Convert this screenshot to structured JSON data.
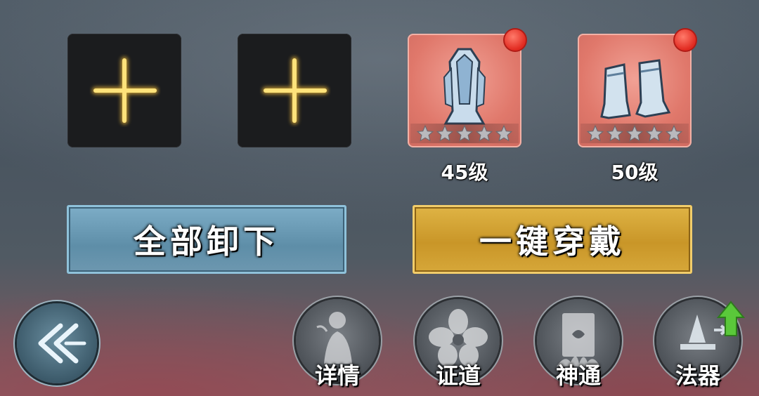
{
  "slots": [
    {
      "type": "empty",
      "icon": "plus-icon"
    },
    {
      "type": "empty",
      "icon": "plus-icon"
    },
    {
      "type": "item",
      "icon": "armor-icon",
      "stars": 5,
      "level": "45级",
      "badge": true
    },
    {
      "type": "item",
      "icon": "boots-icon",
      "stars": 5,
      "level": "50级",
      "badge": true
    }
  ],
  "actions": {
    "unequip_all": "全部卸下",
    "equip_all": "一键穿戴"
  },
  "bottom_nav": [
    {
      "label": "详情",
      "icon": "figure-icon"
    },
    {
      "label": "证道",
      "icon": "flower-icon"
    },
    {
      "label": "神通",
      "icon": "tablet-icon"
    },
    {
      "label": "法器",
      "icon": "artifact-icon"
    }
  ],
  "colors": {
    "unequip_btn": "#6e98b0",
    "equip_btn": "#c99628",
    "badge": "#e12a20",
    "upgrade_arrow": "#5ac83a"
  }
}
